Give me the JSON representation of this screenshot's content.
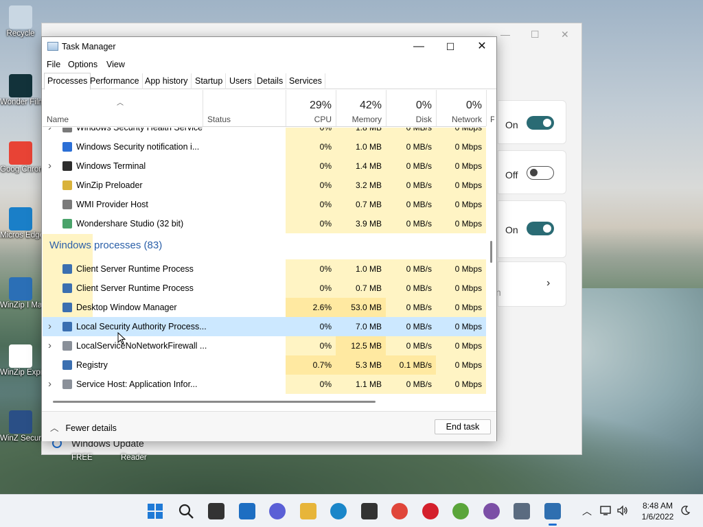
{
  "desktop": {
    "icons": [
      {
        "label": "Recycle",
        "color": "#c9d7e3"
      },
      {
        "label": "Wonder Filmo",
        "color": "#12323a"
      },
      {
        "label": "Goog Chron",
        "color": "#e84335"
      },
      {
        "label": "Micros Edge",
        "color": "#1a7fc8"
      },
      {
        "label": "WinZip I Mana",
        "color": "#2b6fb6"
      },
      {
        "label": "WinZip Expre",
        "color": "#ffffff"
      },
      {
        "label": "WinZ Secur",
        "color": "#2a4f86"
      }
    ],
    "bottom_labels": [
      "FREE",
      "Reader"
    ]
  },
  "behind_window": {
    "toggles": [
      {
        "state": "On",
        "on": true
      },
      {
        "state": "Off",
        "on": false
      },
      {
        "state": "On",
        "on": true
      }
    ],
    "card4_partial": "n",
    "windows_update": "Windows Update"
  },
  "task_manager": {
    "title": "Task Manager",
    "menu": [
      "File",
      "Options",
      "View"
    ],
    "tabs": [
      "Processes",
      "Performance",
      "App history",
      "Startup",
      "Users",
      "Details",
      "Services"
    ],
    "active_tab": "Processes",
    "columns": {
      "name": "Name",
      "status": "Status",
      "cpu": {
        "pct": "29%",
        "label": "CPU"
      },
      "memory": {
        "pct": "42%",
        "label": "Memory"
      },
      "disk": {
        "pct": "0%",
        "label": "Disk"
      },
      "network": {
        "pct": "0%",
        "label": "Network"
      },
      "power_partial": "Po"
    },
    "partial_top_row": {
      "name": "Windows Security Health Service",
      "cpu": "0%",
      "mem": "1.8 MB",
      "disk": "0 MB/s",
      "net": "0 Mbps"
    },
    "apps_rows": [
      {
        "name": "Windows Security notification i...",
        "cpu": "0%",
        "mem": "1.0 MB",
        "disk": "0 MB/s",
        "net": "0 Mbps",
        "expand": false,
        "icon": "shield-icon"
      },
      {
        "name": "Windows Terminal",
        "cpu": "0%",
        "mem": "1.4 MB",
        "disk": "0 MB/s",
        "net": "0 Mbps",
        "expand": true,
        "icon": "terminal-icon"
      },
      {
        "name": "WinZip Preloader",
        "cpu": "0%",
        "mem": "3.2 MB",
        "disk": "0 MB/s",
        "net": "0 Mbps",
        "expand": false,
        "icon": "winzip-icon"
      },
      {
        "name": "WMI Provider Host",
        "cpu": "0%",
        "mem": "0.7 MB",
        "disk": "0 MB/s",
        "net": "0 Mbps",
        "expand": false,
        "icon": "service-icon"
      },
      {
        "name": "Wondershare Studio (32 bit)",
        "cpu": "0%",
        "mem": "3.9 MB",
        "disk": "0 MB/s",
        "net": "0 Mbps",
        "expand": false,
        "icon": "app-icon"
      }
    ],
    "group_title": "Windows processes (83)",
    "windows_rows": [
      {
        "name": "Client Server Runtime Process",
        "cpu": "0%",
        "mem": "1.0 MB",
        "disk": "0 MB/s",
        "net": "0 Mbps",
        "expand": false,
        "icon": "window-icon"
      },
      {
        "name": "Client Server Runtime Process",
        "cpu": "0%",
        "mem": "0.7 MB",
        "disk": "0 MB/s",
        "net": "0 Mbps",
        "expand": false,
        "icon": "window-icon"
      },
      {
        "name": "Desktop Window Manager",
        "cpu": "2.6%",
        "mem": "53.0 MB",
        "disk": "0 MB/s",
        "net": "0 Mbps",
        "expand": false,
        "icon": "window-icon"
      },
      {
        "name": "Local Security Authority Process...",
        "cpu": "0%",
        "mem": "7.0 MB",
        "disk": "0 MB/s",
        "net": "0 Mbps",
        "expand": true,
        "icon": "window-icon",
        "selected": true
      },
      {
        "name": "LocalServiceNoNetworkFirewall ...",
        "cpu": "0%",
        "mem": "12.5 MB",
        "disk": "0 MB/s",
        "net": "0 Mbps",
        "expand": true,
        "icon": "gear-icon"
      },
      {
        "name": "Registry",
        "cpu": "0.7%",
        "mem": "5.3 MB",
        "disk": "0.1 MB/s",
        "net": "0 Mbps",
        "expand": false,
        "icon": "window-icon"
      },
      {
        "name": "Service Host: Application Infor...",
        "cpu": "0%",
        "mem": "1.1 MB",
        "disk": "0 MB/s",
        "net": "0 Mbps",
        "expand": true,
        "icon": "gear-icon"
      }
    ],
    "fewer_details": "Fewer details",
    "end_task": "End task"
  },
  "taskbar": {
    "time": "8:48 AM",
    "date": "1/6/2022",
    "apps": [
      "start-icon",
      "search-icon",
      "task-view-icon",
      "widgets-icon",
      "chat-icon",
      "file-explorer-icon",
      "edge-icon",
      "store-icon",
      "chrome-icon",
      "opera-icon",
      "utorrent-icon",
      "tor-icon",
      "settings-icon",
      "task-manager-icon"
    ]
  }
}
